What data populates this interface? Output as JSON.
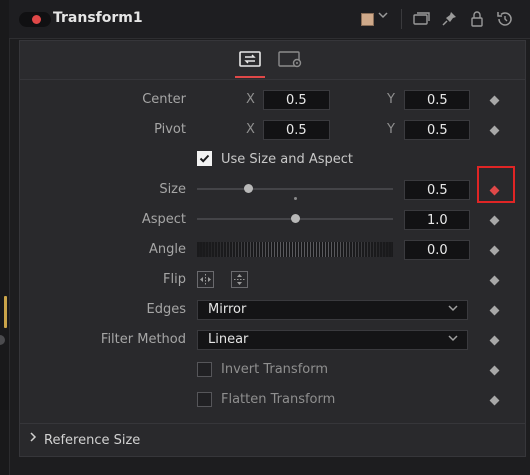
{
  "header": {
    "title": "Transform1",
    "color": "#cfa98a",
    "enabled": true
  },
  "tabs": [
    {
      "icon": "transform-controls-icon",
      "active": true
    },
    {
      "icon": "settings-icon",
      "active": false
    }
  ],
  "center": {
    "label": "Center",
    "x_label": "X",
    "x": "0.5",
    "y_label": "Y",
    "y": "0.5"
  },
  "pivot": {
    "label": "Pivot",
    "x_label": "X",
    "x": "0.5",
    "y_label": "Y",
    "y": "0.5"
  },
  "use_size_aspect": {
    "label": "Use Size and Aspect",
    "checked": true
  },
  "size": {
    "label": "Size",
    "value": "0.5"
  },
  "aspect": {
    "label": "Aspect",
    "value": "1.0"
  },
  "angle": {
    "label": "Angle",
    "value": "0.0"
  },
  "flip": {
    "label": "Flip"
  },
  "edges": {
    "label": "Edges",
    "value": "Mirror"
  },
  "filter_method": {
    "label": "Filter Method",
    "value": "Linear"
  },
  "invert_transform": {
    "label": "Invert Transform",
    "checked": false
  },
  "flatten_transform": {
    "label": "Flatten Transform",
    "checked": false
  },
  "reference_size": {
    "label": "Reference Size"
  },
  "colors": {
    "accent": "#e04848",
    "highlight": "#e02525"
  }
}
